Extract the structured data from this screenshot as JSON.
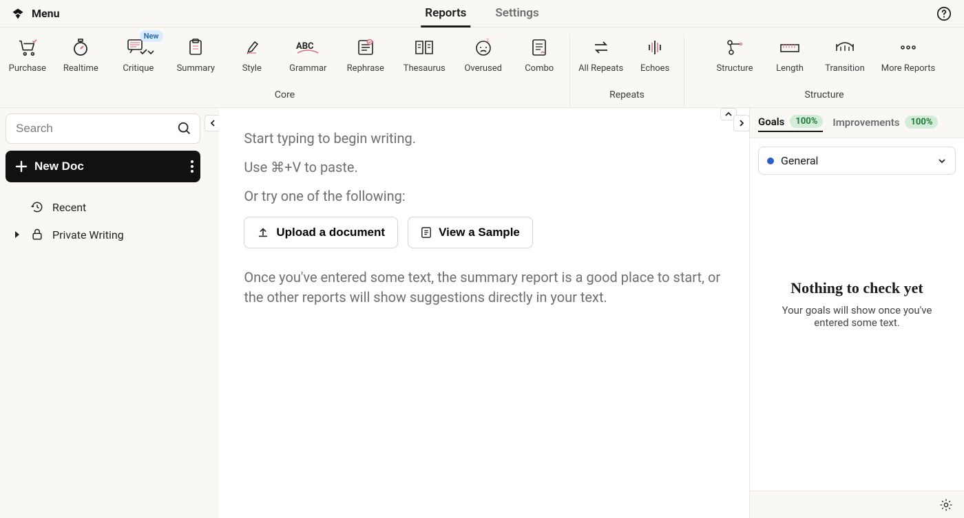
{
  "topbar": {
    "menu_label": "Menu",
    "tabs": {
      "reports": "Reports",
      "settings": "Settings"
    }
  },
  "toolbar": {
    "critique_badge": "New",
    "items": {
      "purchase": "Purchase",
      "realtime": "Realtime",
      "critique": "Critique",
      "summary": "Summary",
      "style": "Style",
      "grammar": "Grammar",
      "rephrase": "Rephrase",
      "thesaurus": "Thesaurus",
      "overused": "Overused",
      "combo": "Combo",
      "all_repeats": "All Repeats",
      "echoes": "Echoes",
      "structure": "Structure",
      "length": "Length",
      "transition": "Transition",
      "more_reports": "More Reports"
    },
    "group_labels": {
      "core": "Core",
      "repeats": "Repeats",
      "structure": "Structure"
    }
  },
  "sidebar": {
    "search_placeholder": "Search",
    "new_doc": "New Doc",
    "recent": "Recent",
    "private": "Private Writing"
  },
  "editor": {
    "line1": "Start typing to begin writing.",
    "line2": "Use ⌘+V to paste.",
    "line3": "Or try one of the following:",
    "upload_label": "Upload a document",
    "sample_label": "View a Sample",
    "help_text": "Once you've entered some text, the summary report is a good place to start, or the other reports will show suggestions directly in your text."
  },
  "rightpanel": {
    "tabs": {
      "goals": "Goals",
      "goals_pct": "100%",
      "improvements": "Improvements",
      "improvements_pct": "100%"
    },
    "dropdown_label": "General",
    "empty_title": "Nothing to check yet",
    "empty_sub": "Your goals will show once you've entered some text."
  }
}
